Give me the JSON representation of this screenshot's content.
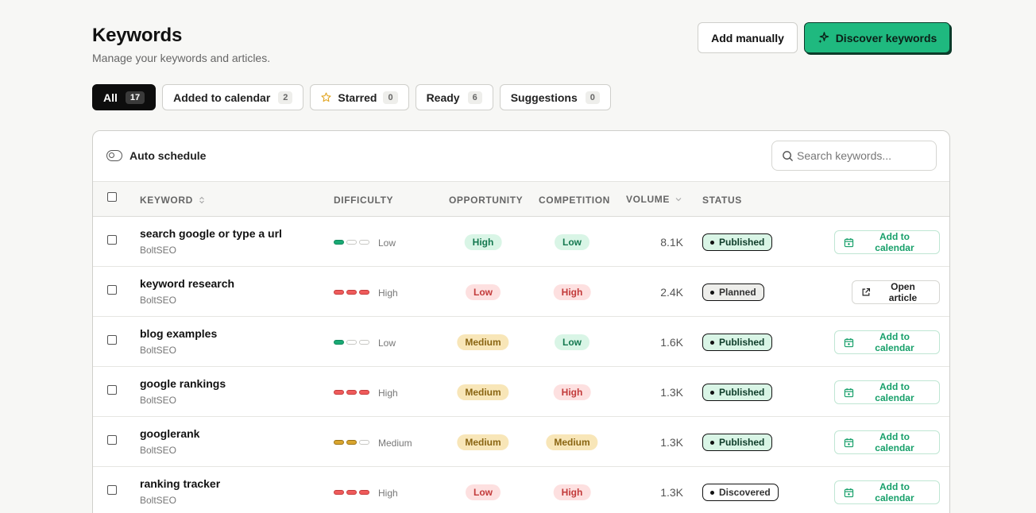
{
  "header": {
    "title": "Keywords",
    "subtitle": "Manage your keywords and articles.",
    "add_manually_label": "Add manually",
    "discover_label": "Discover keywords"
  },
  "tabs": [
    {
      "label": "All",
      "count": "17",
      "active": true
    },
    {
      "label": "Added to calendar",
      "count": "2"
    },
    {
      "label": "Starred",
      "count": "0",
      "icon": "star-icon"
    },
    {
      "label": "Ready",
      "count": "6"
    },
    {
      "label": "Suggestions",
      "count": "0"
    }
  ],
  "toolbar": {
    "auto_schedule_label": "Auto schedule",
    "search_placeholder": "Search keywords..."
  },
  "columns": {
    "keyword": "KEYWORD",
    "difficulty": "DIFFICULTY",
    "opportunity": "OPPORTUNITY",
    "competition": "COMPETITION",
    "volume": "VOLUME",
    "status": "STATUS"
  },
  "rows": [
    {
      "keyword": "search google or type a url",
      "site": "BoltSEO",
      "difficulty": "Low",
      "opportunity": "High",
      "competition": "Low",
      "volume": "8.1K",
      "status": "Published",
      "action": "Add to calendar"
    },
    {
      "keyword": "keyword research",
      "site": "BoltSEO",
      "difficulty": "High",
      "opportunity": "Low",
      "competition": "High",
      "volume": "2.4K",
      "status": "Planned",
      "action": "Open article"
    },
    {
      "keyword": "blog examples",
      "site": "BoltSEO",
      "difficulty": "Low",
      "opportunity": "Medium",
      "competition": "Low",
      "volume": "1.6K",
      "status": "Published",
      "action": "Add to calendar"
    },
    {
      "keyword": "google rankings",
      "site": "BoltSEO",
      "difficulty": "High",
      "opportunity": "Medium",
      "competition": "High",
      "volume": "1.3K",
      "status": "Published",
      "action": "Add to calendar"
    },
    {
      "keyword": "googlerank",
      "site": "BoltSEO",
      "difficulty": "Medium",
      "opportunity": "Medium",
      "competition": "Medium",
      "volume": "1.3K",
      "status": "Published",
      "action": "Add to calendar"
    },
    {
      "keyword": "ranking tracker",
      "site": "BoltSEO",
      "difficulty": "High",
      "opportunity": "Low",
      "competition": "High",
      "volume": "1.3K",
      "status": "Discovered",
      "action": "Add to calendar"
    }
  ],
  "colors": {
    "accent": "#1fb97f",
    "accent_dark": "#0b3b2a",
    "low": "#19a974",
    "high": "#ef5b5b",
    "medium": "#d9a52e"
  }
}
